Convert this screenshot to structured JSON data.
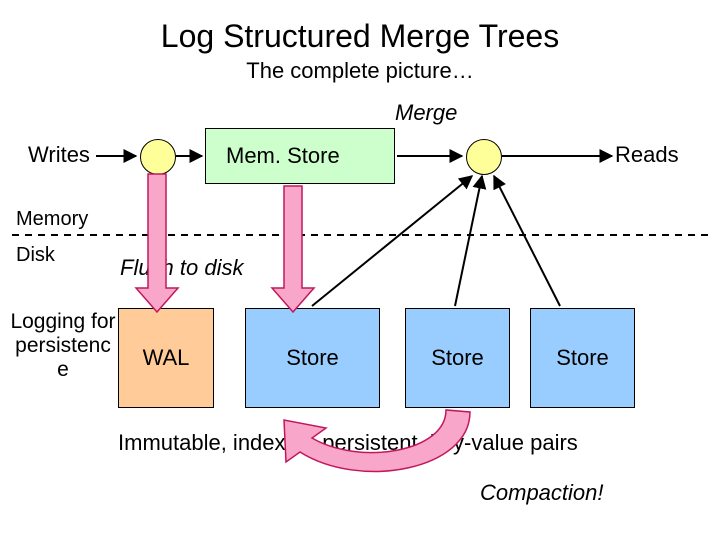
{
  "title": "Log Structured Merge Trees",
  "subtitle": "The complete picture…",
  "labels": {
    "merge": "Merge",
    "writes": "Writes",
    "reads": "Reads",
    "memory": "Memory",
    "disk": "Disk",
    "flush": "Flush to disk",
    "logging": "Logging for persistenc e",
    "immutable": "Immutable, indexed, persistent, key-value pairs",
    "compaction": "Compaction!"
  },
  "nodes": {
    "memstore": "Mem. Store",
    "wal": "WAL",
    "store1": "Store",
    "store2": "Store",
    "store3": "Store"
  },
  "colors": {
    "memstore": "#ccffcc",
    "wal": "#ffcc99",
    "store": "#99ccff",
    "circle": "#ffff99",
    "arrow_pink": "#f8a6c9",
    "arrow_pink_stroke": "#c2185b",
    "arrow_black": "#000000"
  }
}
